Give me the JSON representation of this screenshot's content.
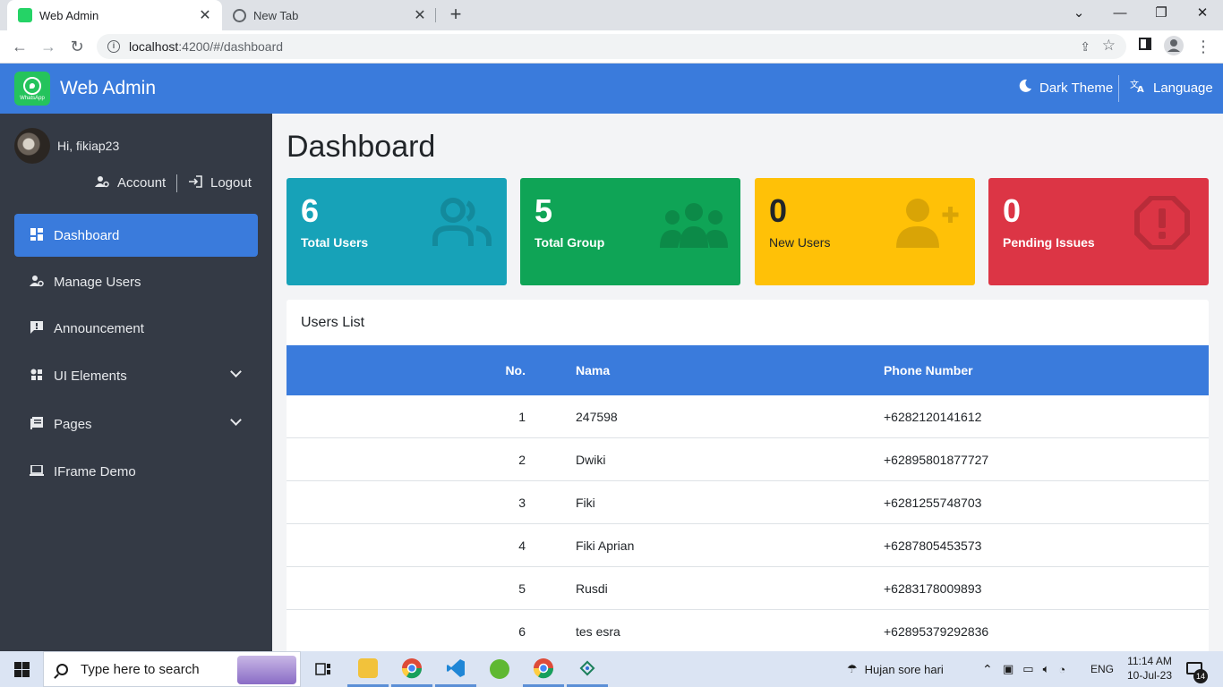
{
  "browser": {
    "tabs": [
      {
        "title": "Web Admin",
        "close": "✕"
      },
      {
        "title": "New Tab",
        "close": "✕"
      }
    ],
    "new_tab": "+",
    "window_controls": {
      "dropdown": "⌄",
      "minimize": "—",
      "restore": "❐",
      "close": "✕"
    },
    "url_host": "localhost",
    "url_path": ":4200/#/dashboard",
    "nav": {
      "back": "←",
      "forward": "→",
      "reload": "↻"
    }
  },
  "header": {
    "brand": "Web Admin",
    "logo_text": "WhatsApp",
    "dark_theme_label": "Dark Theme",
    "language_label": "Language",
    "accent_color": "#3a7bdc"
  },
  "sidebar": {
    "greeting": "Hi, fikiap23",
    "account_label": "Account",
    "logout_label": "Logout",
    "items": [
      {
        "label": "Dashboard",
        "icon": "dashboard-icon",
        "active": true
      },
      {
        "label": "Manage Users",
        "icon": "users-gear-icon"
      },
      {
        "label": "Announcement",
        "icon": "announcement-icon"
      },
      {
        "label": "UI Elements",
        "icon": "shapes-icon",
        "expandable": true
      },
      {
        "label": "Pages",
        "icon": "pages-icon",
        "expandable": true
      },
      {
        "label": "IFrame Demo",
        "icon": "laptop-icon"
      }
    ]
  },
  "main": {
    "page_title": "Dashboard",
    "cards": [
      {
        "value": "6",
        "label": "Total Users",
        "color": "#17a2b8",
        "icon": "users-icon"
      },
      {
        "value": "5",
        "label": "Total Group",
        "color": "#0fa456",
        "icon": "group-icon"
      },
      {
        "value": "0",
        "label": "New Users",
        "color": "#ffc107",
        "icon": "user-plus-icon"
      },
      {
        "value": "0",
        "label": "Pending Issues",
        "color": "#dc3545",
        "icon": "alert-octagon-icon"
      }
    ],
    "users_list": {
      "title": "Users List",
      "columns": [
        "No.",
        "Nama",
        "Phone Number"
      ],
      "rows": [
        {
          "no": "1",
          "nama": "247598",
          "phone": "+6282120141612"
        },
        {
          "no": "2",
          "nama": "Dwiki",
          "phone": "+62895801877727"
        },
        {
          "no": "3",
          "nama": "Fiki",
          "phone": "+6281255748703"
        },
        {
          "no": "4",
          "nama": "Fiki Aprian",
          "phone": "+6287805453573"
        },
        {
          "no": "5",
          "nama": "Rusdi",
          "phone": "+6283178009893"
        },
        {
          "no": "6",
          "nama": "tes esra",
          "phone": "+62895379292836"
        }
      ]
    }
  },
  "taskbar": {
    "search_placeholder": "Type here to search",
    "weather": "Hujan sore hari",
    "lang": "ENG",
    "time": "11:14 AM",
    "date": "10-Jul-23",
    "notifications": "14"
  }
}
